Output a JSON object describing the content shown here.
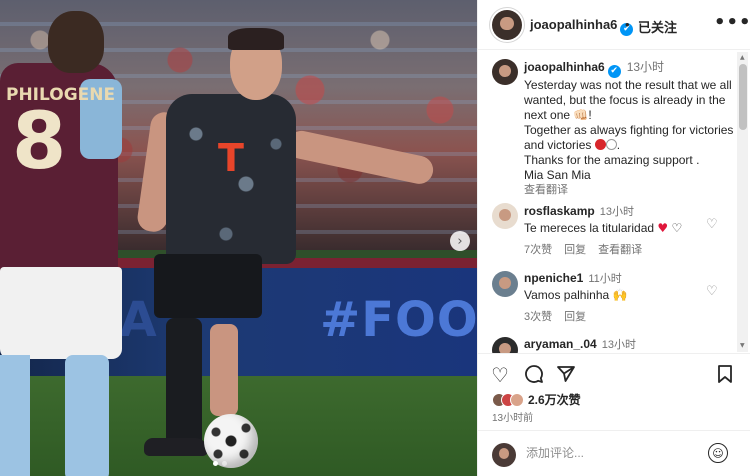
{
  "post": {
    "photo": {
      "board_left_text": "E A",
      "board_right_text": "#FOOTB",
      "opponent_name": "PHILOGENE",
      "opponent_number": "8",
      "jersey_logo": "T",
      "next_icon": "chevron-right-icon",
      "slides_total": 2,
      "slide_active": 1
    },
    "header": {
      "username": "joaopalhinha6",
      "verified": "✔",
      "separator": "•",
      "follow_status": "已关注",
      "more": "•••"
    },
    "caption": {
      "username": "joaopalhinha6",
      "verified": "✔",
      "time": "13小时",
      "lines": [
        "Yesterday was not the result that we all wanted, but the focus is already in the next one 👊🏻!",
        "Together as always fighting for victories and victories",
        "Thanks for the amazing support .",
        "Mia San Mia"
      ],
      "see_translation": "查看翻译"
    },
    "comments": [
      {
        "username": "rosflaskamp",
        "time": "13小时",
        "text": "Te mereces la titularidad",
        "likes": "7次赞",
        "reply": "回复",
        "translate": "查看翻译"
      },
      {
        "username": "npeniche1",
        "time": "11小时",
        "text": "Vamos palhinha 🙌",
        "likes": "3次赞",
        "reply": "回复"
      },
      {
        "username": "aryaman_.04",
        "time": "13小时",
        "text": "..."
      }
    ],
    "actions": {
      "like_icon": "heart-icon",
      "comment_icon": "comment-icon",
      "share_icon": "send-icon",
      "save_icon": "bookmark-icon",
      "likes_count": "2.6万次赞",
      "posted_time": "13小时前"
    },
    "add_comment": {
      "placeholder": "添加评论...",
      "emoji": "☺"
    },
    "colors": {
      "verified_blue": "#0095f6",
      "muted_text": "#737373",
      "heart_red": "#e0163b"
    }
  }
}
